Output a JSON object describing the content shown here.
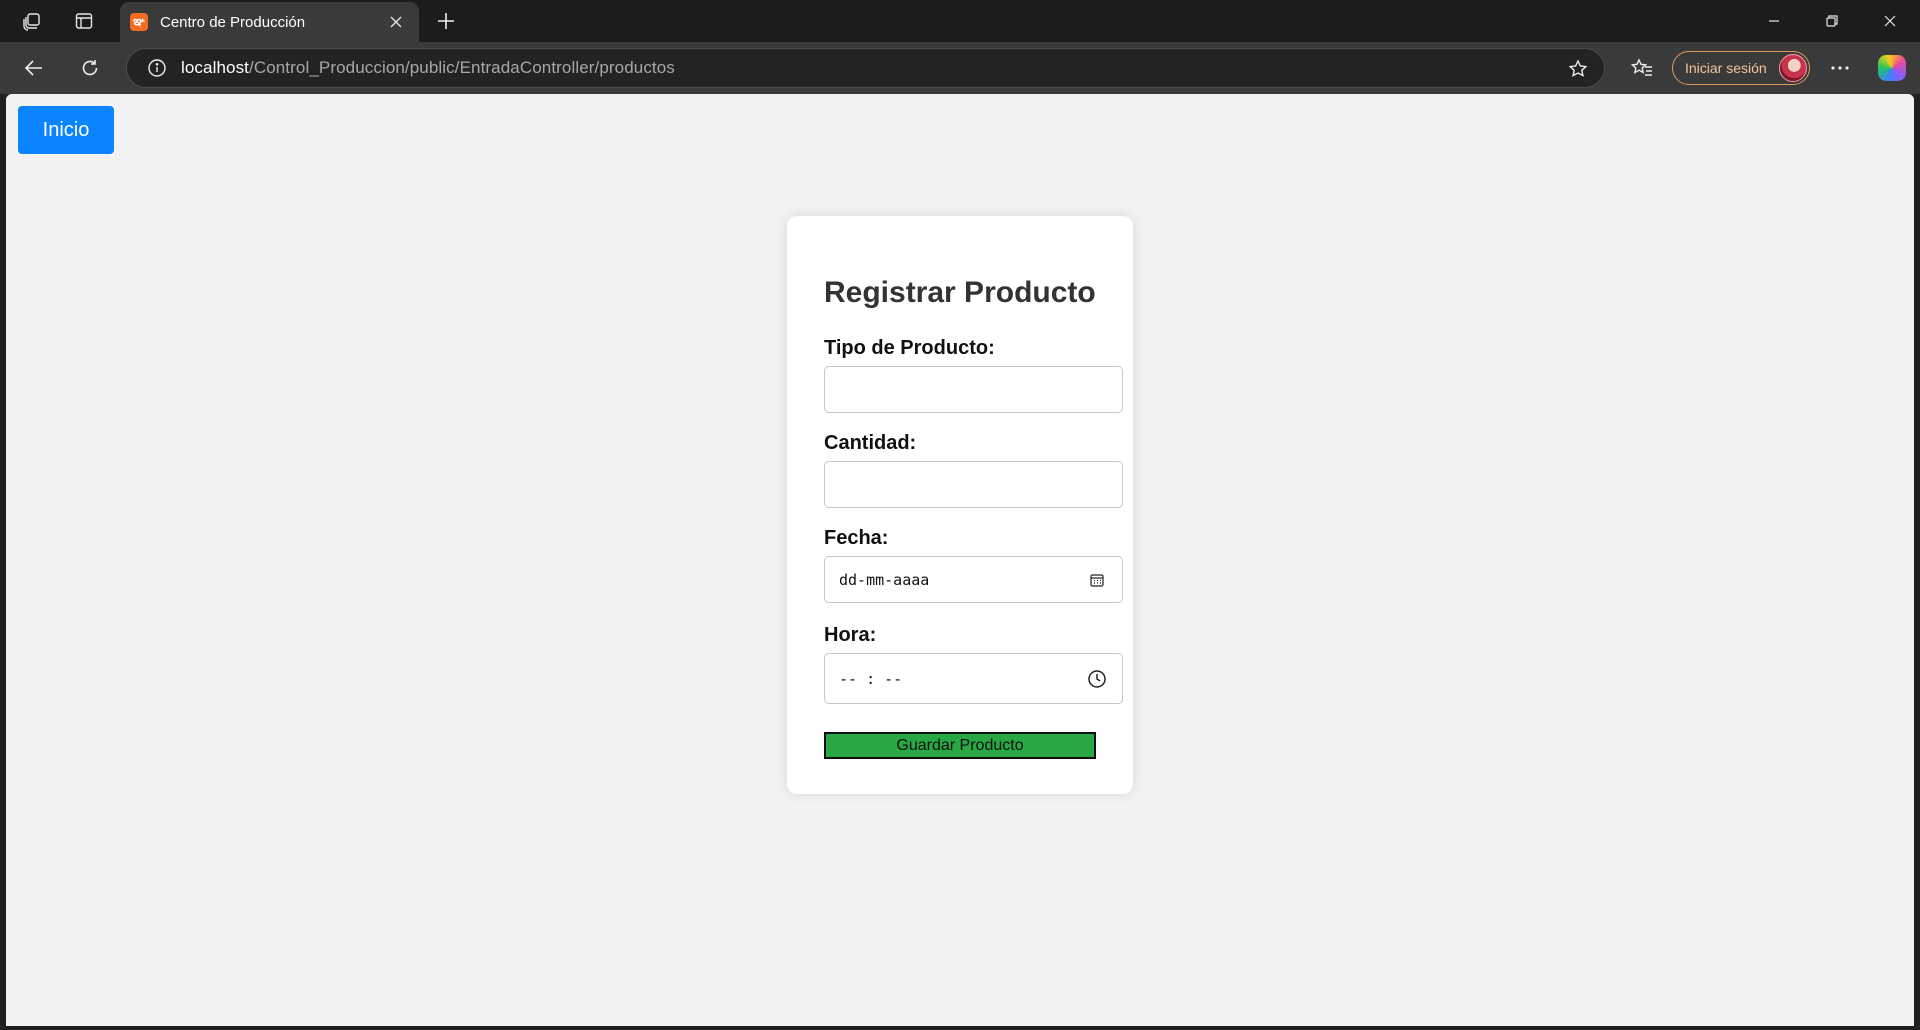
{
  "browser": {
    "tab": {
      "title": "Centro de Producción",
      "favicon_icon": "xampp-icon"
    },
    "address": {
      "host": "localhost",
      "path": "/Control_Produccion/public/EntradaController/productos"
    },
    "signin_label": "Iniciar sesión"
  },
  "page": {
    "home_button": "Inicio",
    "form": {
      "title": "Registrar Producto",
      "tipo_label": "Tipo de Producto:",
      "tipo_value": "",
      "cantidad_label": "Cantidad:",
      "cantidad_value": "",
      "fecha_label": "Fecha:",
      "fecha_placeholder": "dd-mm-aaaa",
      "hora_label": "Hora:",
      "hora_placeholder": "-- : --",
      "submit_label": "Guardar Producto"
    }
  },
  "colors": {
    "primary_button": "#0b84ff",
    "submit_button": "#28a745",
    "page_background": "#f2f2f2"
  }
}
